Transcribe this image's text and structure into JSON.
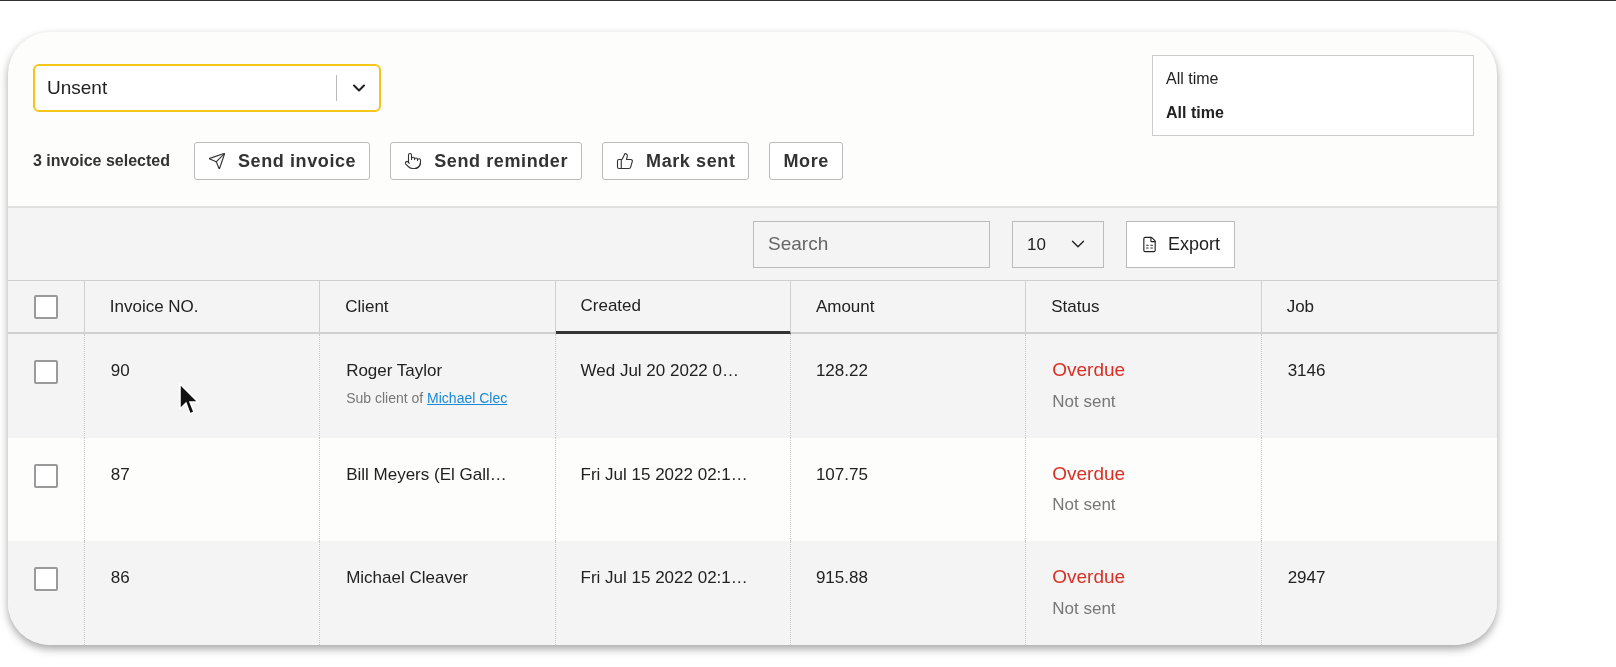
{
  "filter": {
    "value": "Unsent"
  },
  "selection": {
    "label": "3 invoice selected"
  },
  "actions": [
    {
      "kind": "send",
      "label": "Send invoice"
    },
    {
      "kind": "reminder",
      "label": "Send reminder"
    },
    {
      "kind": "mark",
      "label": "Mark sent"
    },
    {
      "kind": "menu",
      "label": "More"
    }
  ],
  "date_range": {
    "label": "All time",
    "value": "All time"
  },
  "toolbar": {
    "search_placeholder": "Search",
    "page_size": "10",
    "export": "Export"
  },
  "table": {
    "columns": [
      {
        "label": "Invoice NO.",
        "selected": false
      },
      {
        "label": "Client",
        "selected": false
      },
      {
        "label": "Created",
        "selected": true
      },
      {
        "label": "Amount",
        "selected": false
      },
      {
        "label": "Status",
        "selected": false
      },
      {
        "label": "Job",
        "selected": false
      }
    ],
    "select_all": {
      "checked": false
    },
    "rows": [
      {
        "checked": false,
        "invoice": "90",
        "client": "Roger Taylor",
        "sub_client_prefix": "Sub client of",
        "sub_client_link": "Michael Clec",
        "created": "Wed Jul 20 2022 0…",
        "amount": "128.22",
        "status": "Overdue",
        "kind": "overdue",
        "delivery": "Not sent",
        "job": "3146"
      },
      {
        "checked": false,
        "invoice": "87",
        "client": "Bill Meyers (El Gall…",
        "created": "Fri Jul 15 2022 02:1…",
        "amount": "107.75",
        "status": "Overdue",
        "kind": "overdue",
        "delivery": "Not sent"
      },
      {
        "checked": false,
        "invoice": "86",
        "client": "Michael Cleaver",
        "created": "Fri Jul 15 2022 02:1…",
        "amount": "915.88",
        "status": "Overdue",
        "kind": "overdue",
        "delivery": "Not sent",
        "job": "2947"
      }
    ]
  }
}
